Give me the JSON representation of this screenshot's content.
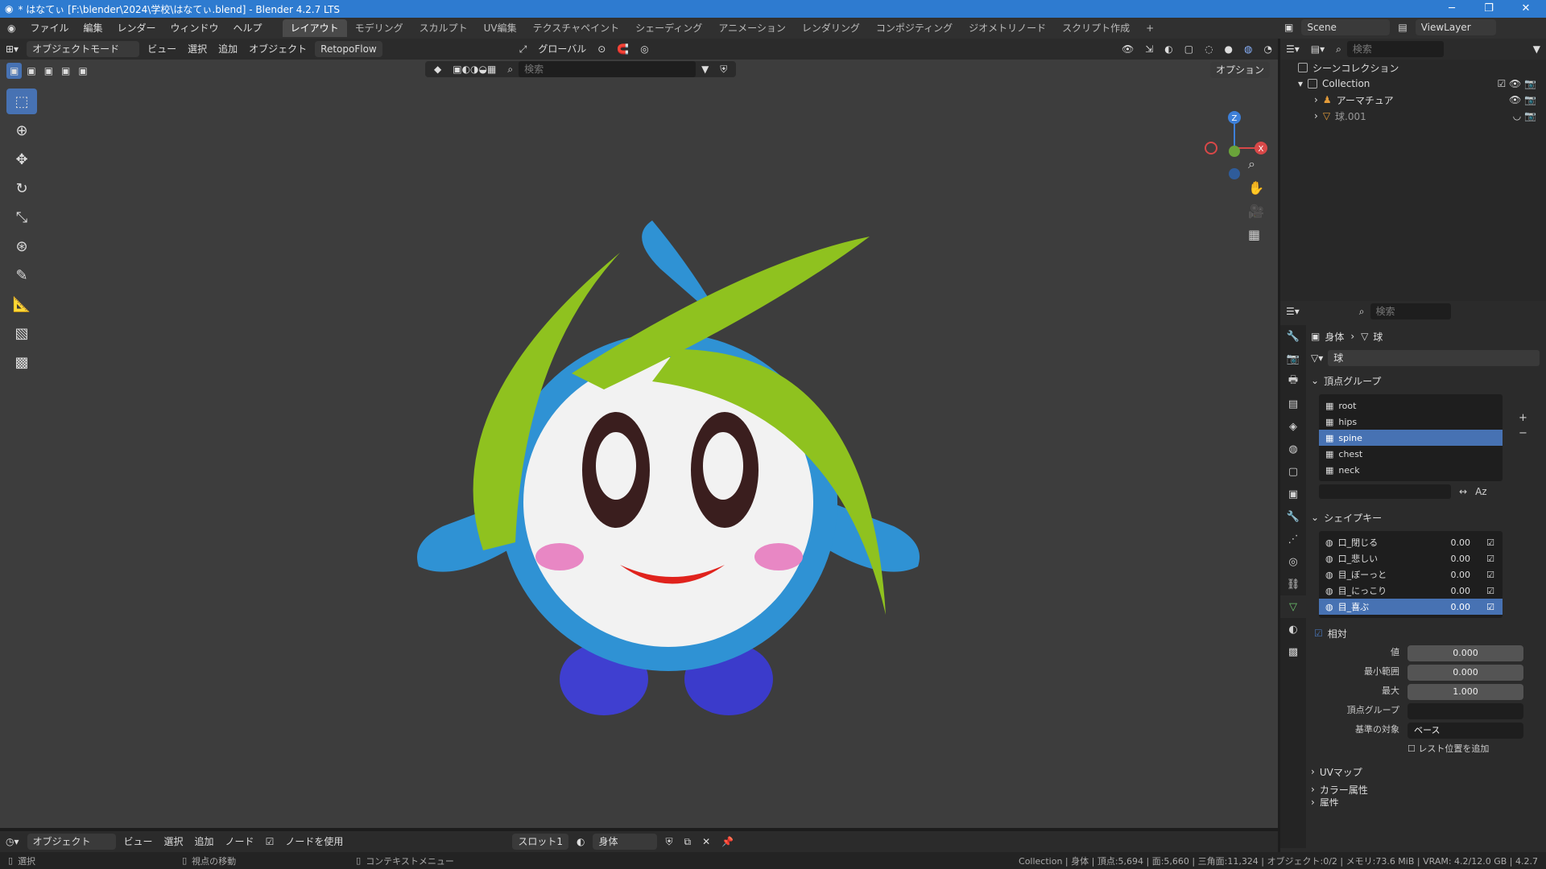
{
  "titlebar": {
    "title": "* はなてぃ [F:\\blender\\2024\\学校\\はなてぃ.blend] - Blender 4.2.7 LTS",
    "minimize": "─",
    "maximize": "❐",
    "close": "✕"
  },
  "menu": {
    "items": [
      "ファイル",
      "編集",
      "レンダー",
      "ウィンドウ",
      "ヘルプ"
    ]
  },
  "workspaces": [
    "レイアウト",
    "モデリング",
    "スカルプト",
    "UV編集",
    "テクスチャペイント",
    "シェーディング",
    "アニメーション",
    "レンダリング",
    "コンポジティング",
    "ジオメトリノード",
    "スクリプト作成"
  ],
  "scene": {
    "name": "Scene",
    "view_layer": "ViewLayer"
  },
  "viewport_header": {
    "mode": "オブジェクトモード",
    "view": "ビュー",
    "select": "選択",
    "add": "追加",
    "object": "オブジェクト",
    "addon": "RetopoFlow",
    "transform": "グローバル",
    "options": "オプション",
    "search_placeholder": "検索"
  },
  "bottom_header": {
    "mode": "オブジェクト",
    "view": "ビュー",
    "select": "選択",
    "add": "追加",
    "node": "ノード",
    "use_nodes": "ノードを使用",
    "slot": "スロット1",
    "material": "身体"
  },
  "status": {
    "left1": "選択",
    "left2": "視点の移動",
    "left3": "コンテキストメニュー",
    "right": "Collection | 身体 | 頂点:5,694 | 面:5,660 | 三角面:11,324 | オブジェクト:0/2 | メモリ:73.6 MiB | VRAM: 4.2/12.0 GB | 4.2.7"
  },
  "outliner": {
    "search_placeholder": "検索",
    "root": "シーンコレクション",
    "collection": "Collection",
    "items": [
      "アーマチュア",
      "球.001"
    ]
  },
  "properties": {
    "search_placeholder": "検索",
    "breadcrumb_object": "身体",
    "breadcrumb_data": "球",
    "mesh_name": "球",
    "vertex_groups_title": "頂点グループ",
    "vertex_groups": [
      "root",
      "hips",
      "spine",
      "chest",
      "neck"
    ],
    "shape_keys_title": "シェイプキー",
    "shape_keys": [
      {
        "name": "口_閉じる",
        "value": "0.00"
      },
      {
        "name": "口_悲しい",
        "value": "0.00"
      },
      {
        "name": "目_ぼーっと",
        "value": "0.00"
      },
      {
        "name": "目_にっこり",
        "value": "0.00"
      },
      {
        "name": "目_喜ぶ",
        "value": "0.00"
      }
    ],
    "relative": "相対",
    "value_label": "値",
    "value": "0.000",
    "min_label": "最小範囲",
    "min": "0.000",
    "max_label": "最大",
    "max": "1.000",
    "vgroup_label": "頂点グループ",
    "base_label": "基準の対象",
    "base_value": "ベース",
    "rest_label": "レスト位置を追加",
    "uv_maps": "UVマップ",
    "color_attrs": "カラー属性",
    "attrs": "属性"
  },
  "gizmo": {
    "x": "X",
    "y": "Y",
    "z": "Z"
  },
  "colors": {
    "accent": "#4772b3",
    "title": "#2e7bd0"
  }
}
